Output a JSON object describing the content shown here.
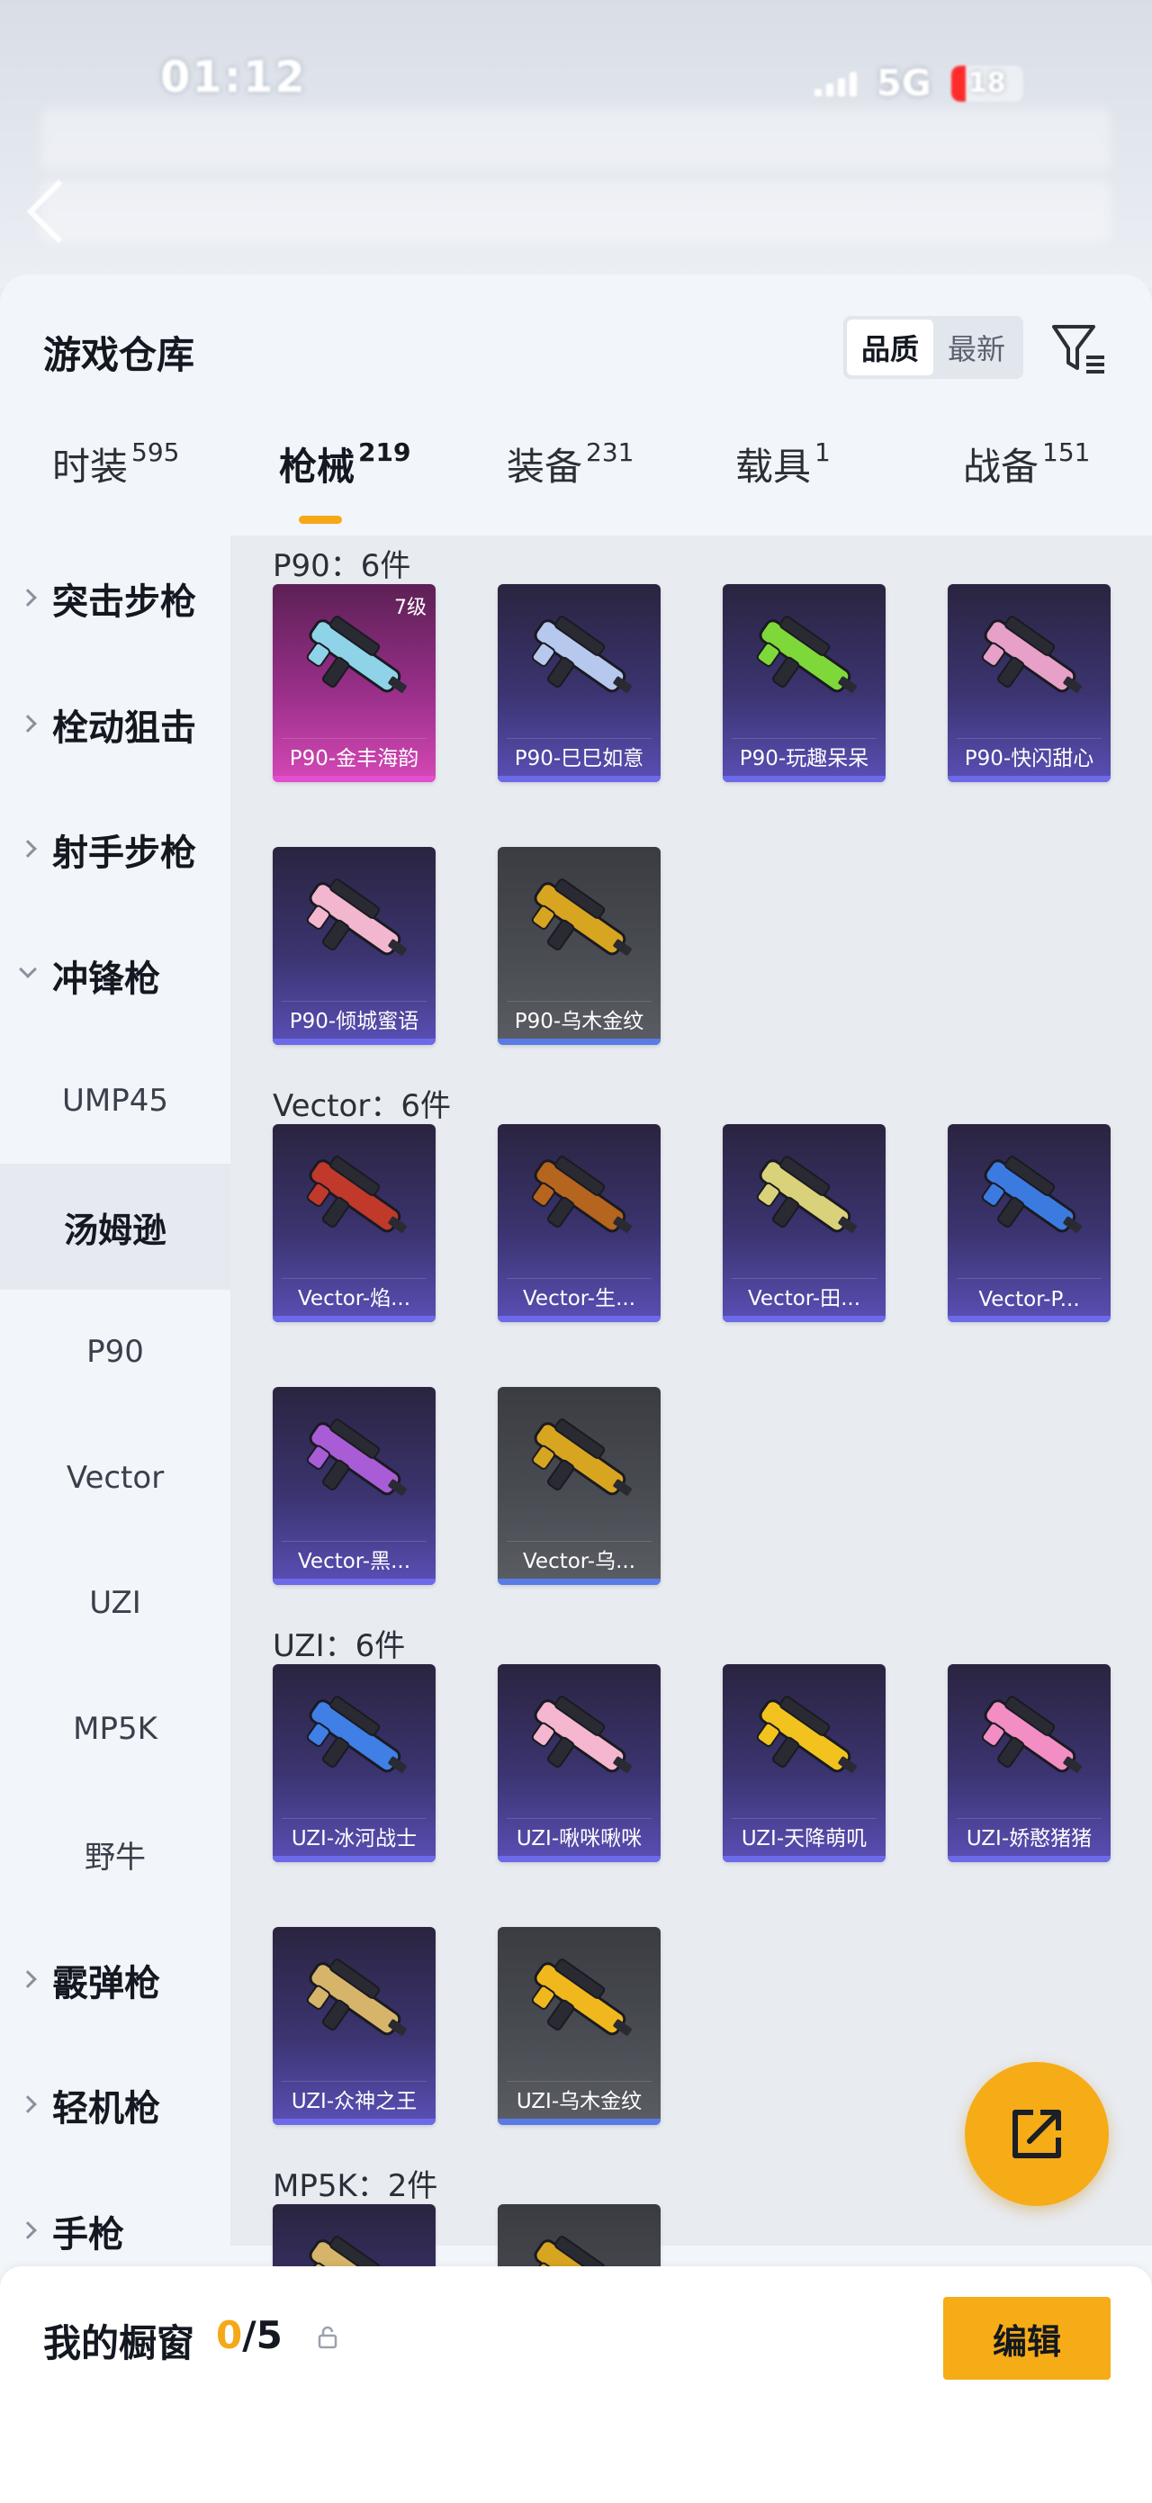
{
  "status_bar": {
    "time": "01:12",
    "network": "5G",
    "battery": "18"
  },
  "header": {
    "title": "游戏仓库",
    "sort_options": [
      "品质",
      "最新"
    ],
    "active_sort": "品质"
  },
  "tabs": [
    {
      "label": "时装",
      "count": "595"
    },
    {
      "label": "枪械",
      "count": "219"
    },
    {
      "label": "装备",
      "count": "231"
    },
    {
      "label": "载具",
      "count": "1"
    },
    {
      "label": "战备",
      "count": "151"
    }
  ],
  "active_tab": "枪械",
  "sidebar": {
    "items": [
      {
        "label": "突击步枪",
        "type": "category",
        "expanded": false
      },
      {
        "label": "栓动狙击",
        "type": "category",
        "expanded": false
      },
      {
        "label": "射手步枪",
        "type": "category",
        "expanded": false
      },
      {
        "label": "冲锋枪",
        "type": "category",
        "expanded": true
      },
      {
        "label": "UMP45",
        "type": "sub"
      },
      {
        "label": "汤姆逊",
        "type": "sub",
        "selected": true
      },
      {
        "label": "P90",
        "type": "sub"
      },
      {
        "label": "Vector",
        "type": "sub"
      },
      {
        "label": "UZI",
        "type": "sub"
      },
      {
        "label": "MP5K",
        "type": "sub"
      },
      {
        "label": "野牛",
        "type": "sub"
      },
      {
        "label": "霰弹枪",
        "type": "category",
        "expanded": false
      },
      {
        "label": "轻机枪",
        "type": "category",
        "expanded": false
      },
      {
        "label": "手枪",
        "type": "category",
        "expanded": false
      }
    ]
  },
  "groups": [
    {
      "title": "P90：6件",
      "items": [
        {
          "name": "P90-金丰海韵",
          "level": "7级",
          "tier": "pink",
          "accent": "#8fd3e8"
        },
        {
          "name": "P90-巳巳如意",
          "tier": "purple",
          "accent": "#b7c8ee"
        },
        {
          "name": "P90-玩趣呆呆",
          "tier": "purple",
          "accent": "#7ed83a"
        },
        {
          "name": "P90-快闪甜心",
          "tier": "purple",
          "accent": "#e7a0c8"
        },
        {
          "name": "P90-倾城蜜语",
          "tier": "purple",
          "accent": "#f3b6cf"
        },
        {
          "name": "P90-乌木金纹",
          "tier": "gray",
          "accent": "#d8a520"
        }
      ]
    },
    {
      "title": "Vector：6件",
      "items": [
        {
          "name": "Vector-焰...",
          "tier": "purple",
          "accent": "#c0392b"
        },
        {
          "name": "Vector-生...",
          "tier": "purple",
          "accent": "#b5651d"
        },
        {
          "name": "Vector-田...",
          "tier": "purple",
          "accent": "#d9d27a"
        },
        {
          "name": "Vector-P...",
          "tier": "purple",
          "accent": "#3b7be0"
        },
        {
          "name": "Vector-黑...",
          "tier": "purple",
          "accent": "#a85cd6"
        },
        {
          "name": "Vector-乌...",
          "tier": "gray",
          "accent": "#d8a520"
        }
      ]
    },
    {
      "title": "UZI：6件",
      "items": [
        {
          "name": "UZI-冰河战士",
          "tier": "purple",
          "accent": "#3f7fe6"
        },
        {
          "name": "UZI-啾咪啾咪",
          "tier": "purple",
          "accent": "#f4b7cf"
        },
        {
          "name": "UZI-天降萌叽",
          "tier": "purple",
          "accent": "#f2c21e"
        },
        {
          "name": "UZI-娇憨猪猪",
          "tier": "purple",
          "accent": "#f28ec3"
        },
        {
          "name": "UZI-众神之王",
          "tier": "purple",
          "accent": "#d6b56a"
        },
        {
          "name": "UZI-乌木金纹",
          "tier": "gray",
          "accent": "#f0b81c"
        }
      ]
    },
    {
      "title": "MP5K：2件",
      "items": [
        {
          "name": "",
          "tier": "purple",
          "accent": "#d6b56a"
        },
        {
          "name": "",
          "tier": "gray",
          "accent": "#d8a520"
        }
      ]
    }
  ],
  "showcase": {
    "label": "我的橱窗",
    "current": "0",
    "total": "/5",
    "edit_label": "编辑"
  },
  "icons": {
    "filter": "filter-icon",
    "share": "share-icon",
    "lock": "lock-icon",
    "back": "back-arrow-icon"
  },
  "colors": {
    "accent": "#f6ac17",
    "selected_tab_underline": "#f5a918"
  }
}
